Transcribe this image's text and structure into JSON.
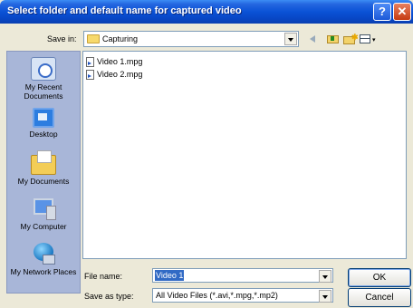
{
  "window": {
    "title": "Select folder and default name for captured video",
    "help_glyph": "?",
    "close_glyph": "✕"
  },
  "save_in": {
    "label": "Save in:",
    "value": "Capturing"
  },
  "places": [
    {
      "label": "My Recent Documents",
      "icon": "recent-documents-icon"
    },
    {
      "label": "Desktop",
      "icon": "desktop-icon"
    },
    {
      "label": "My Documents",
      "icon": "my-documents-icon"
    },
    {
      "label": "My Computer",
      "icon": "my-computer-icon"
    },
    {
      "label": "My Network Places",
      "icon": "network-places-icon"
    }
  ],
  "files": [
    {
      "name": "Video 1.mpg"
    },
    {
      "name": "Video 2.mpg"
    }
  ],
  "file_name": {
    "label": "File name:",
    "value": "Video 1"
  },
  "file_type": {
    "label": "Save as type:",
    "value": "All Video Files (*.avi,*.mpg,*.mp2)"
  },
  "buttons": {
    "ok": "OK",
    "cancel": "Cancel"
  },
  "colors": {
    "title_bar": "#0a52d6",
    "places_bar": "#a8b6d8",
    "selection": "#316ac5"
  }
}
